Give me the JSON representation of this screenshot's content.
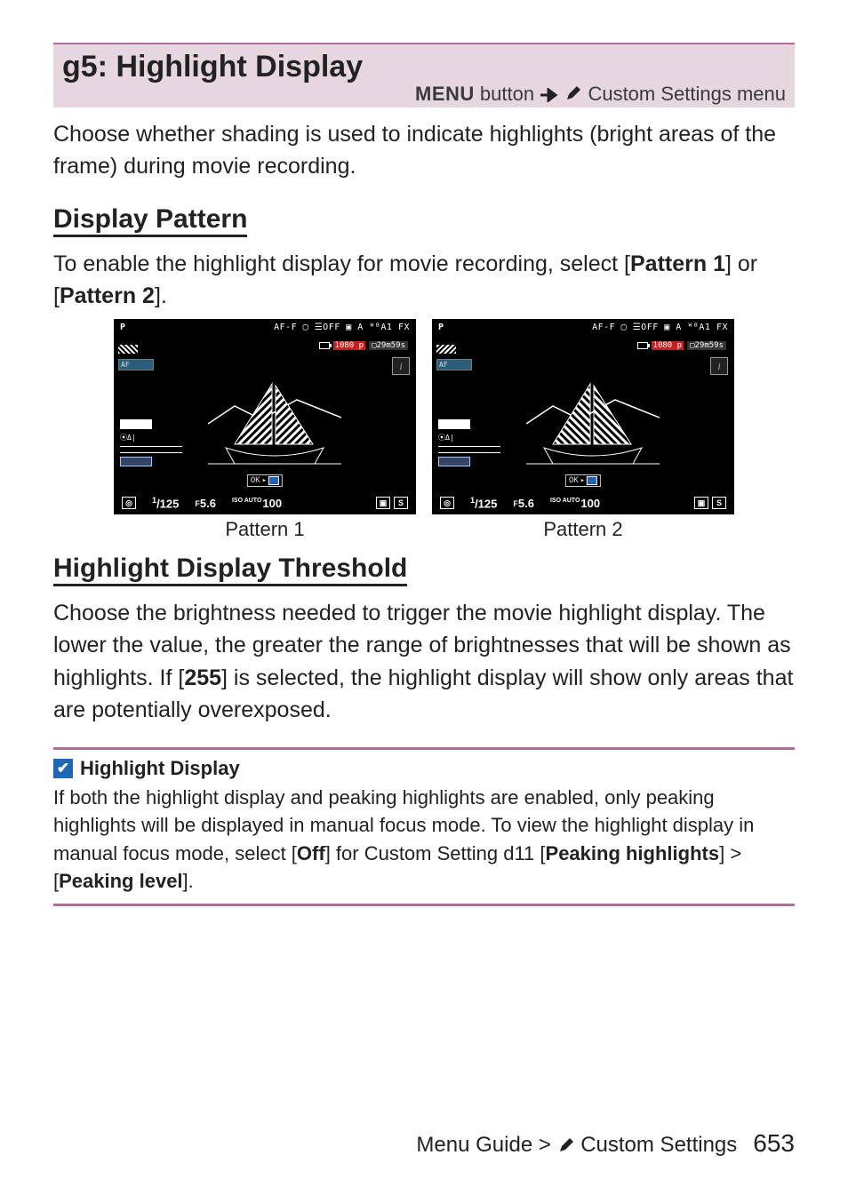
{
  "titlebox": {
    "title": "g5: Highlight Display",
    "menu_word": "MENU",
    "menu_rest": " button ",
    "menu_end": " Custom Settings menu"
  },
  "intro": "Choose whether shading is used to indicate highlights (bright areas of the frame) during movie recording.",
  "section1": {
    "heading": "Display Pattern",
    "p_a": "To enable the highlight display for movie recording, select [",
    "p_b": "Pattern 1",
    "p_c": "] or [",
    "p_d": "Pattern 2",
    "p_e": "]."
  },
  "figures": {
    "cap1": "Pattern 1",
    "cap2": "Pattern 2",
    "lcd": {
      "top_left": "P",
      "top_right": "AF-F ▢ ☰OFF ▣ A ᵂᴮA1  FX",
      "redrec": {
        "rb": "1080 p",
        "tc": "▢29m59s"
      },
      "wbtxt": "WB",
      "aftxt": "AF",
      "zebraA": "⌀",
      "shutter": "1/125",
      "shutter_sup": "1",
      "aperture": "5.6",
      "aperture_pre": "F",
      "iso": "100",
      "iso_sm": "ISO\nAUTO",
      "ok": "OK"
    }
  },
  "section2": {
    "heading": "Highlight Display Threshold",
    "p_a": "Choose the brightness needed to trigger the movie highlight display. The lower the value, the greater the range of brightnesses that will be shown as highlights. If [",
    "p_b": "255",
    "p_c": "] is selected, the highlight display will show only areas that are potentially overexposed."
  },
  "tip": {
    "head": "Highlight Display",
    "body_a": "If both the highlight display and peaking highlights are enabled, only peaking highlights will be displayed in manual focus mode. To view the highlight display in manual focus mode, select [",
    "body_b": "Off",
    "body_c": "] for Custom Setting d11 [",
    "body_d": "Peaking highlights",
    "body_e": "] > [",
    "body_f": "Peaking level",
    "body_g": "]."
  },
  "footer": {
    "path_a": "Menu Guide > ",
    "path_b": " Custom Settings",
    "page": "653"
  }
}
